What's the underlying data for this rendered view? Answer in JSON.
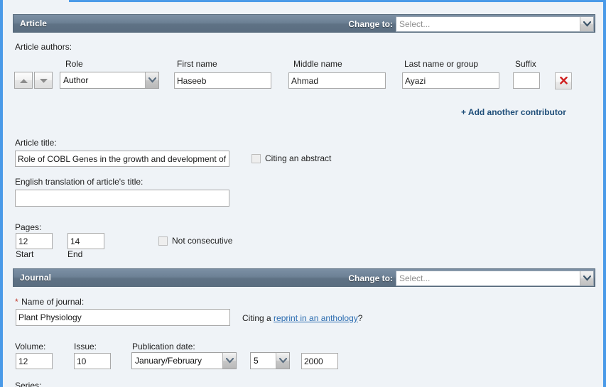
{
  "sections": {
    "article": {
      "title": "Article",
      "change_to_label": "Change to:",
      "change_to_value": "Select...",
      "authors_label": "Article authors:",
      "columns": {
        "role": "Role",
        "first_name": "First name",
        "middle_name": "Middle name",
        "last_name": "Last name or group",
        "suffix": "Suffix"
      },
      "contributor": {
        "role_value": "Author",
        "first_name_value": "Haseeb",
        "middle_name_value": "Ahmad",
        "last_name_value": "Ayazi",
        "suffix_value": ""
      },
      "add_contributor_link": "+ Add another contributor",
      "article_title_label": "Article title:",
      "article_title_value": "Role of COBL Genes in the growth and development of",
      "citing_abstract_label": "Citing an abstract",
      "citing_abstract_checked": false,
      "english_translation_label": "English translation of article's title:",
      "english_translation_value": "",
      "pages_label": "Pages:",
      "pages_start_value": "12",
      "pages_end_value": "14",
      "pages_start_caption": "Start",
      "pages_end_caption": "End",
      "not_consecutive_label": "Not consecutive",
      "not_consecutive_checked": false
    },
    "journal": {
      "title": "Journal",
      "change_to_label": "Change to:",
      "change_to_value": "Select...",
      "name_label_star": "*",
      "name_label": "Name of journal:",
      "name_value": "Plant Physiology",
      "reprint_prefix": "Citing a ",
      "reprint_link": "reprint in an anthology",
      "reprint_suffix": "?",
      "volume_label": "Volume:",
      "volume_value": "12",
      "issue_label": "Issue:",
      "issue_value": "10",
      "pubdate_label": "Publication date:",
      "pubdate_month_value": "January/February",
      "pubdate_day_value": "5",
      "pubdate_year_value": "2000",
      "series_label": "Series:"
    }
  },
  "colors": {
    "accent_blue": "#4a9ae8",
    "page_bg": "#eff3f7",
    "bar_dark": "#5f7285",
    "link_bold": "#1f4e79",
    "link_underline": "#2b6cb0",
    "required_star": "#c0392b"
  }
}
